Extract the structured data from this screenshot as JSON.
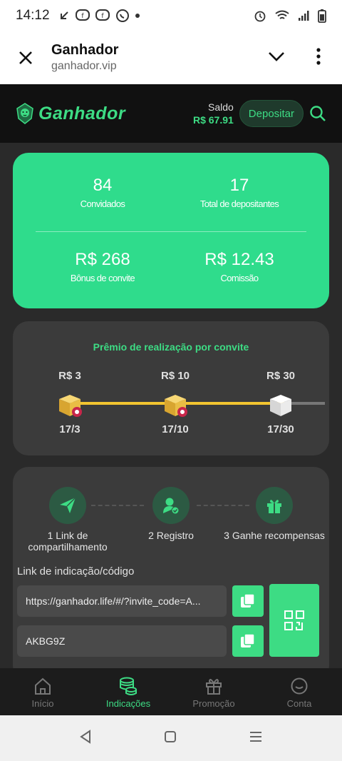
{
  "status_bar": {
    "time": "14:12"
  },
  "browser": {
    "title": "Ganhador",
    "url": "ganhador.vip"
  },
  "header": {
    "logo_text": "Ganhador",
    "balance_label": "Saldo",
    "balance_value": "R$ 67.91",
    "deposit_label": "Depositar"
  },
  "stats": {
    "invited_value": "84",
    "invited_label": "Convidados",
    "depositors_value": "17",
    "depositors_label": "Total de depositantes",
    "bonus_value": "R$ 268",
    "bonus_label": "Bônus de convite",
    "commission_value": "R$ 12.43",
    "commission_label": "Comissão"
  },
  "prize": {
    "title": "Prêmio de realização por convite",
    "milestones": [
      {
        "amount": "R$ 3",
        "progress": "17/3",
        "done": true
      },
      {
        "amount": "R$ 10",
        "progress": "17/10",
        "done": true
      },
      {
        "amount": "R$ 30",
        "progress": "17/30",
        "done": false
      }
    ]
  },
  "invite": {
    "steps": [
      {
        "label": "1 Link de compartilhamento"
      },
      {
        "label": "2 Registro"
      },
      {
        "label": "3 Ganhe recompensas"
      }
    ],
    "link_label": "Link de indicação/código",
    "link_value": "https://ganhador.life/#/?invite_code=A...",
    "code_value": "AKBG9Z"
  },
  "tabs": [
    {
      "label": "Início",
      "icon": "home-icon"
    },
    {
      "label": "Indicações",
      "icon": "coins-icon"
    },
    {
      "label": "Promoção",
      "icon": "gift-icon"
    },
    {
      "label": "Conta",
      "icon": "account-icon"
    }
  ],
  "colors": {
    "accent": "#3ddc84",
    "card": "#2fdc8c",
    "background": "#2a2a2a",
    "gold": "#f2c530"
  }
}
